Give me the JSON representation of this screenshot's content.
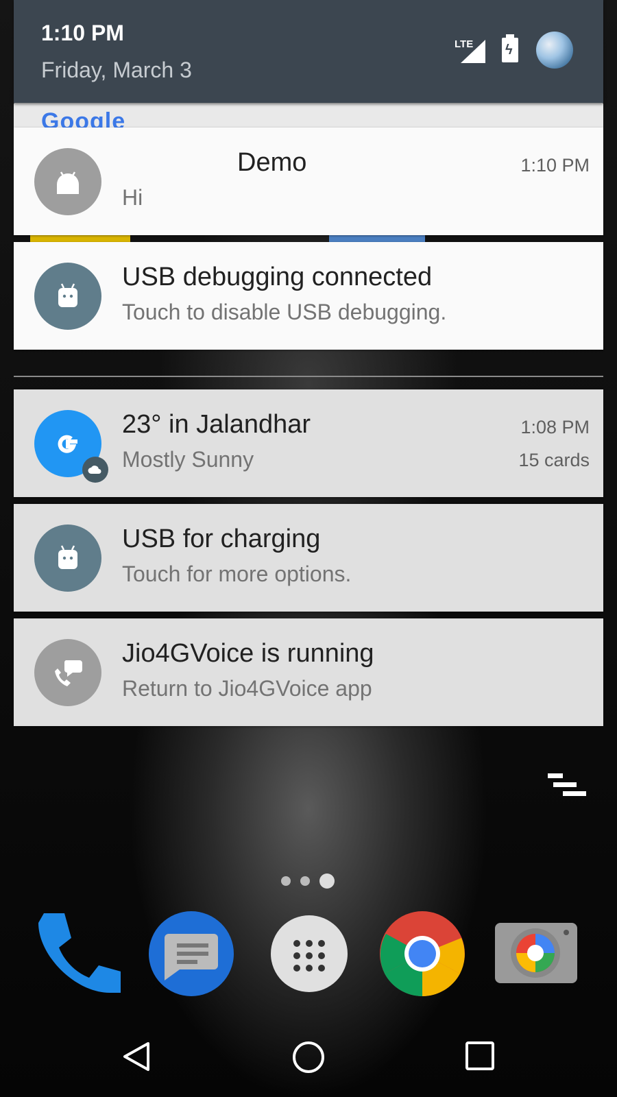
{
  "status_header": {
    "time": "1:10 PM",
    "date": "Friday, March 3",
    "network_label": "LTE",
    "signal_icon": "signal-icon",
    "battery_icon": "battery-charging-icon",
    "avatar_icon": "user-avatar"
  },
  "background_peek": {
    "search_logo": "Google"
  },
  "notifications": [
    {
      "title": "Demo",
      "text": "Hi",
      "time": "1:10 PM",
      "icon": "android-icon",
      "icon_color": "#9e9e9e"
    },
    {
      "title": "USB debugging connected",
      "text": "Touch to disable USB debugging.",
      "icon": "android-head-icon",
      "icon_color": "#607d8b"
    },
    {
      "title": "23° in Jalandhar",
      "text": "Mostly Sunny",
      "time": "1:08 PM",
      "info": "15 cards",
      "icon": "google-icon",
      "icon_color": "#2196f3",
      "badge_icon": "cloud-icon"
    },
    {
      "title": "USB for charging",
      "text": "Touch for more options.",
      "icon": "android-head-icon",
      "icon_color": "#607d8b"
    },
    {
      "title": "Jio4GVoice is running",
      "text": "Return to Jio4GVoice app",
      "icon": "phone-chat-icon",
      "icon_color": "#9e9e9e"
    }
  ],
  "home": {
    "clear_all_icon": "clear-all-icon",
    "page_indicator": {
      "pages": 3,
      "current": 3
    },
    "dock": [
      "phone-icon",
      "messages-icon",
      "app-drawer-icon",
      "chrome-icon",
      "camera-icon"
    ]
  },
  "navigation": [
    "back-icon",
    "home-icon",
    "recents-icon"
  ],
  "colors": {
    "header_bg": "#3c4650",
    "notification_light": "#fafafa",
    "notification_dark": "#e0e0e0"
  }
}
